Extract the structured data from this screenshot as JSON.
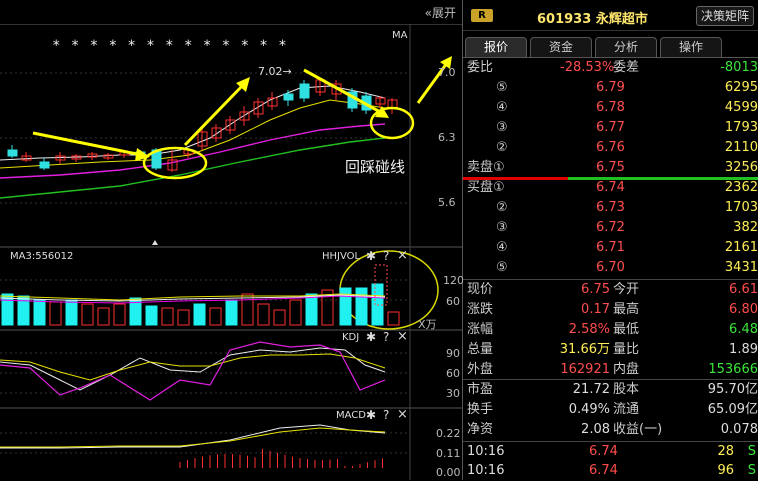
{
  "chart": {
    "expand_label": "«展开",
    "stars": "* * *   * * * * * * * * * *",
    "ma_tag": "MA",
    "price_ticks": [
      "7.0",
      "6.3",
      "5.6"
    ],
    "peak_label": "7.02→",
    "annotation": "回踩碰线",
    "vol_label": "MA3:556012",
    "vol_title": "HHJVOL",
    "vol_ticks": [
      "120",
      "60"
    ],
    "vol_unit": "X万",
    "kdj_title": "KDJ",
    "kdj_ticks": [
      "90",
      "60",
      "30"
    ],
    "macd_title": "MACD",
    "macd_ticks": [
      "0.22",
      "0.11",
      "0.00"
    ],
    "gear_symbol": "✱",
    "help_symbol": "?",
    "close_symbol": "×",
    "arrow_color": "#ffff00"
  },
  "panel": {
    "badge": "R",
    "code": "601933",
    "name": "永辉超市",
    "decision_button": "决策矩阵",
    "tabs": [
      "报价",
      "资金",
      "分析",
      "操作"
    ],
    "weibi": {
      "label": "委比",
      "value": "-28.53%",
      "label2": "委差",
      "value2": "-8013"
    },
    "sell": [
      {
        "label": "⑤",
        "price": "6.79",
        "vol": "6295"
      },
      {
        "label": "④",
        "price": "6.78",
        "vol": "4599"
      },
      {
        "label": "③",
        "price": "6.77",
        "vol": "1793"
      },
      {
        "label": "②",
        "price": "6.76",
        "vol": "2110"
      },
      {
        "label": "卖盘①",
        "price": "6.75",
        "vol": "3256"
      }
    ],
    "buy": [
      {
        "label": "买盘①",
        "price": "6.74",
        "vol": "2362"
      },
      {
        "label": "②",
        "price": "6.73",
        "vol": "1703"
      },
      {
        "label": "③",
        "price": "6.72",
        "vol": "382"
      },
      {
        "label": "④",
        "price": "6.71",
        "vol": "2161"
      },
      {
        "label": "⑤",
        "price": "6.70",
        "vol": "3431"
      }
    ],
    "stats": [
      {
        "l1": "现价",
        "v1": "6.75",
        "c1": "red",
        "l2": "今开",
        "v2": "6.61",
        "c2": "red"
      },
      {
        "l1": "涨跌",
        "v1": "0.17",
        "c1": "red",
        "l2": "最高",
        "v2": "6.80",
        "c2": "red"
      },
      {
        "l1": "涨幅",
        "v1": "2.58%",
        "c1": "red",
        "l2": "最低",
        "v2": "6.48",
        "c2": "green"
      },
      {
        "l1": "总量",
        "v1": "31.66万",
        "c1": "yellow",
        "l2": "量比",
        "v2": "1.89",
        "c2": "white"
      },
      {
        "l1": "外盘",
        "v1": "162921",
        "c1": "red",
        "l2": "内盘",
        "v2": "153666",
        "c2": "green"
      }
    ],
    "stats2": [
      {
        "l1": "市盈",
        "v1": "21.72",
        "l2": "股本",
        "v2": "95.70亿"
      },
      {
        "l1": "换手",
        "v1": "0.49%",
        "l2": "流通",
        "v2": "65.09亿"
      },
      {
        "l1": "净资",
        "v1": "2.08",
        "l2": "收益(一)",
        "v2": "0.078"
      }
    ],
    "ticks": [
      {
        "time": "10:16",
        "price": "6.74",
        "vol": "28",
        "side": "S"
      },
      {
        "time": "10:16",
        "price": "6.74",
        "vol": "96",
        "side": "S"
      }
    ]
  }
}
